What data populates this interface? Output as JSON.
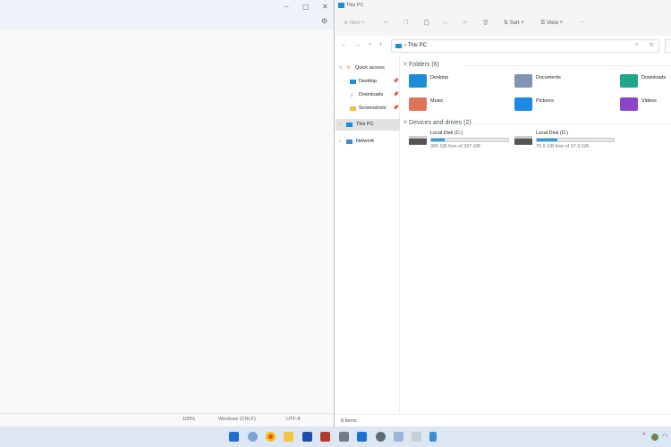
{
  "left_window": {
    "status": {
      "zoom": "100%",
      "line_ending": "Windows (CRLF)",
      "encoding": "UTF-8"
    }
  },
  "explorer": {
    "title": "This PC",
    "toolbar": {
      "new": "New",
      "sort": "Sort",
      "view": "View",
      "more": "···"
    },
    "address": {
      "location": "This PC"
    },
    "nav": [
      {
        "label": "Quick access"
      },
      {
        "label": "Desktop"
      },
      {
        "label": "Downloads"
      },
      {
        "label": "Screenshots"
      },
      {
        "label": "This PC"
      },
      {
        "label": "Network"
      }
    ],
    "folders_header": "Folders (6)",
    "folders": [
      {
        "name": "Desktop",
        "color": "#1a8fd8"
      },
      {
        "name": "Documents",
        "color": "#7f95b3"
      },
      {
        "name": "Downloads",
        "color": "#1fa58a"
      },
      {
        "name": "Music",
        "color": "#e0745a"
      },
      {
        "name": "Pictures",
        "color": "#1e88e5"
      },
      {
        "name": "Videos",
        "color": "#8e44c9"
      }
    ],
    "drives_header": "Devices and drives (2)",
    "drives": [
      {
        "name": "Local Disk (C:)",
        "free": "305 GB free of 367 GB",
        "used_fraction": 0.17
      },
      {
        "name": "Local Disk (D:)",
        "free": "70.9 GB free of 97.0 GB",
        "used_fraction": 0.27
      }
    ],
    "status": "8 items"
  }
}
